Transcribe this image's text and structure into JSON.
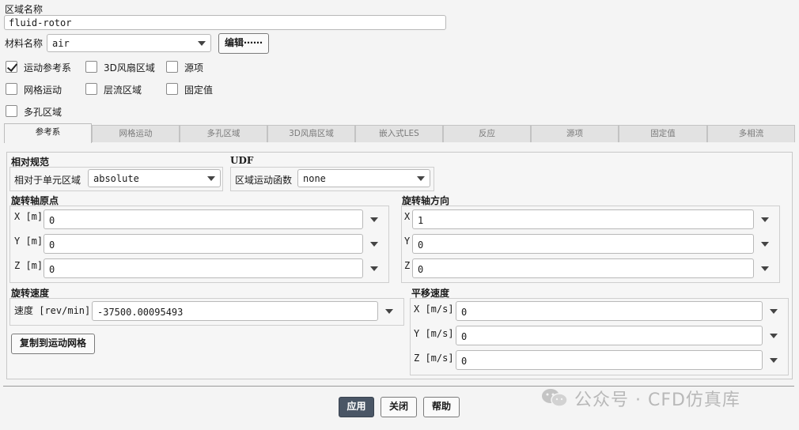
{
  "zone": {
    "name_label": "区域名称",
    "name_value": "fluid-rotor"
  },
  "material": {
    "label": "材料名称",
    "value": "air",
    "edit_button": "编辑⋯⋯"
  },
  "options": [
    {
      "label": "运动参考系",
      "checked": true
    },
    {
      "label": "3D风扇区域",
      "checked": false
    },
    {
      "label": "源项",
      "checked": false
    },
    {
      "label": "网格运动",
      "checked": false
    },
    {
      "label": "层流区域",
      "checked": false
    },
    {
      "label": "固定值",
      "checked": false
    },
    {
      "label": "多孔区域",
      "checked": false
    }
  ],
  "tabs": [
    "参考系",
    "网格运动",
    "多孔区域",
    "3D风扇区域",
    "嵌入式LES",
    "反应",
    "源项",
    "固定值",
    "多相流"
  ],
  "active_tab": 0,
  "relative": {
    "title": "相对规范",
    "label": "相对于单元区域",
    "value": "absolute"
  },
  "udf": {
    "title": "UDF",
    "label": "区域运动函数",
    "value": "none"
  },
  "axis_origin": {
    "title": "旋转轴原点",
    "x_label": "X [m]",
    "x_value": "0",
    "y_label": "Y [m]",
    "y_value": "0",
    "z_label": "Z [m]",
    "z_value": "0"
  },
  "axis_direction": {
    "title": "旋转轴方向",
    "x_label": "X",
    "x_value": "1",
    "y_label": "Y",
    "y_value": "0",
    "z_label": "Z",
    "z_value": "0"
  },
  "rotation": {
    "title": "旋转速度",
    "speed_label": "速度 [rev/min]",
    "speed_value": "-37500.00095493",
    "copy_button": "复制到运动网格"
  },
  "translation": {
    "title": "平移速度",
    "x_label": "X [m/s]",
    "x_value": "0",
    "y_label": "Y [m/s]",
    "y_value": "0",
    "z_label": "Z [m/s]",
    "z_value": "0"
  },
  "footer": {
    "apply": "应用",
    "close": "关闭",
    "help": "帮助"
  },
  "watermark": "公众号 · CFD仿真库"
}
